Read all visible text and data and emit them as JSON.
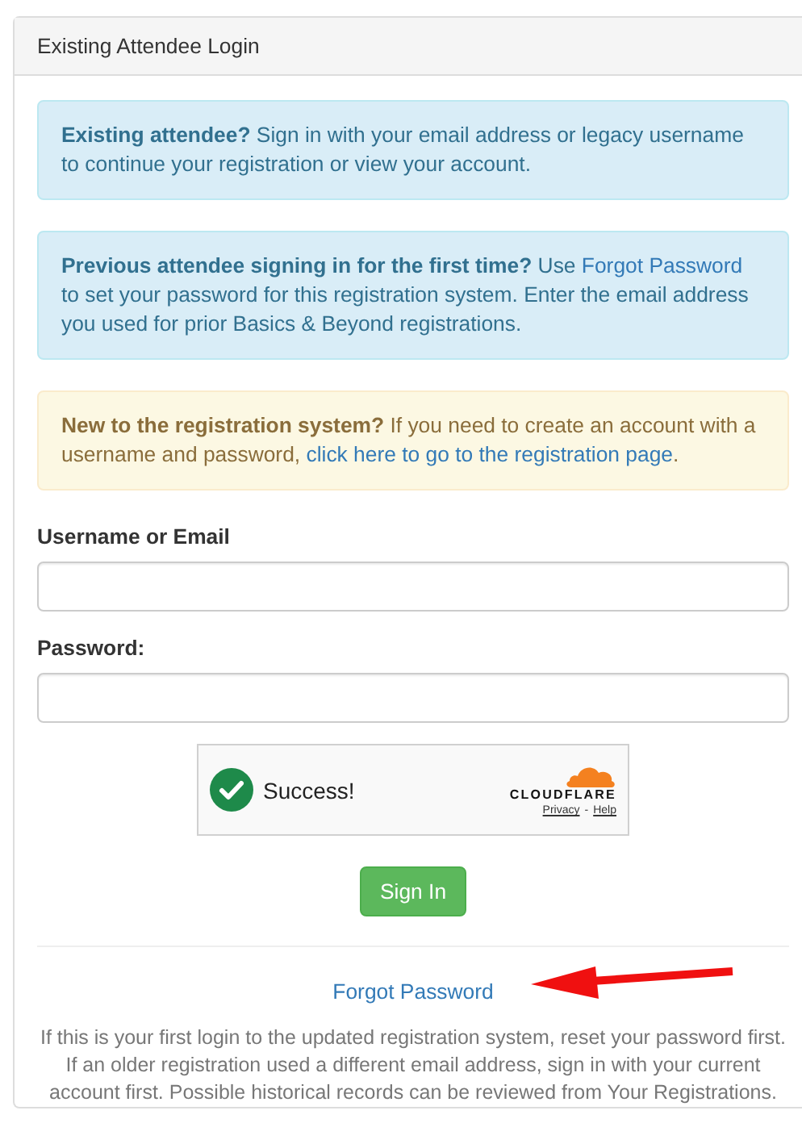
{
  "panel": {
    "title": "Existing Attendee Login"
  },
  "alerts": [
    {
      "kind": "info",
      "segments": [
        {
          "kind": "bold",
          "text": "Existing attendee?"
        },
        {
          "kind": "text",
          "text": " Sign in with your email address or legacy username to continue your registration or view your account."
        }
      ]
    },
    {
      "kind": "info",
      "segments": [
        {
          "kind": "bold",
          "text": "Previous attendee signing in for the first time?"
        },
        {
          "kind": "text",
          "text": " Use "
        },
        {
          "kind": "link",
          "text": "Forgot Password"
        },
        {
          "kind": "text",
          "text": " to set your password for this registration system. Enter the email address you used for prior Basics & Beyond registrations."
        }
      ]
    },
    {
      "kind": "warning",
      "segments": [
        {
          "kind": "bold",
          "text": "New to the registration system?"
        },
        {
          "kind": "text",
          "text": " If you need to create an account with a username and password, "
        },
        {
          "kind": "link",
          "text": "click here to go to the registration page"
        },
        {
          "kind": "text",
          "text": "."
        }
      ]
    }
  ],
  "fields": [
    {
      "label": "Username or Email"
    },
    {
      "label": "Password:"
    }
  ],
  "captcha": {
    "status": "Success!",
    "brand": "CLOUDFLARE",
    "links": [
      "Privacy",
      "Help"
    ],
    "separator": "-"
  },
  "sign_in_button": "Sign In",
  "forgot_password_link": "Forgot Password",
  "annotation": {
    "kind": "arrow"
  },
  "help_text": "If this is your first login to the updated registration system, reset your password first. If an older registration used a different email address, sign in with your current account first. Possible historical records can be reviewed from Your Registrations."
}
